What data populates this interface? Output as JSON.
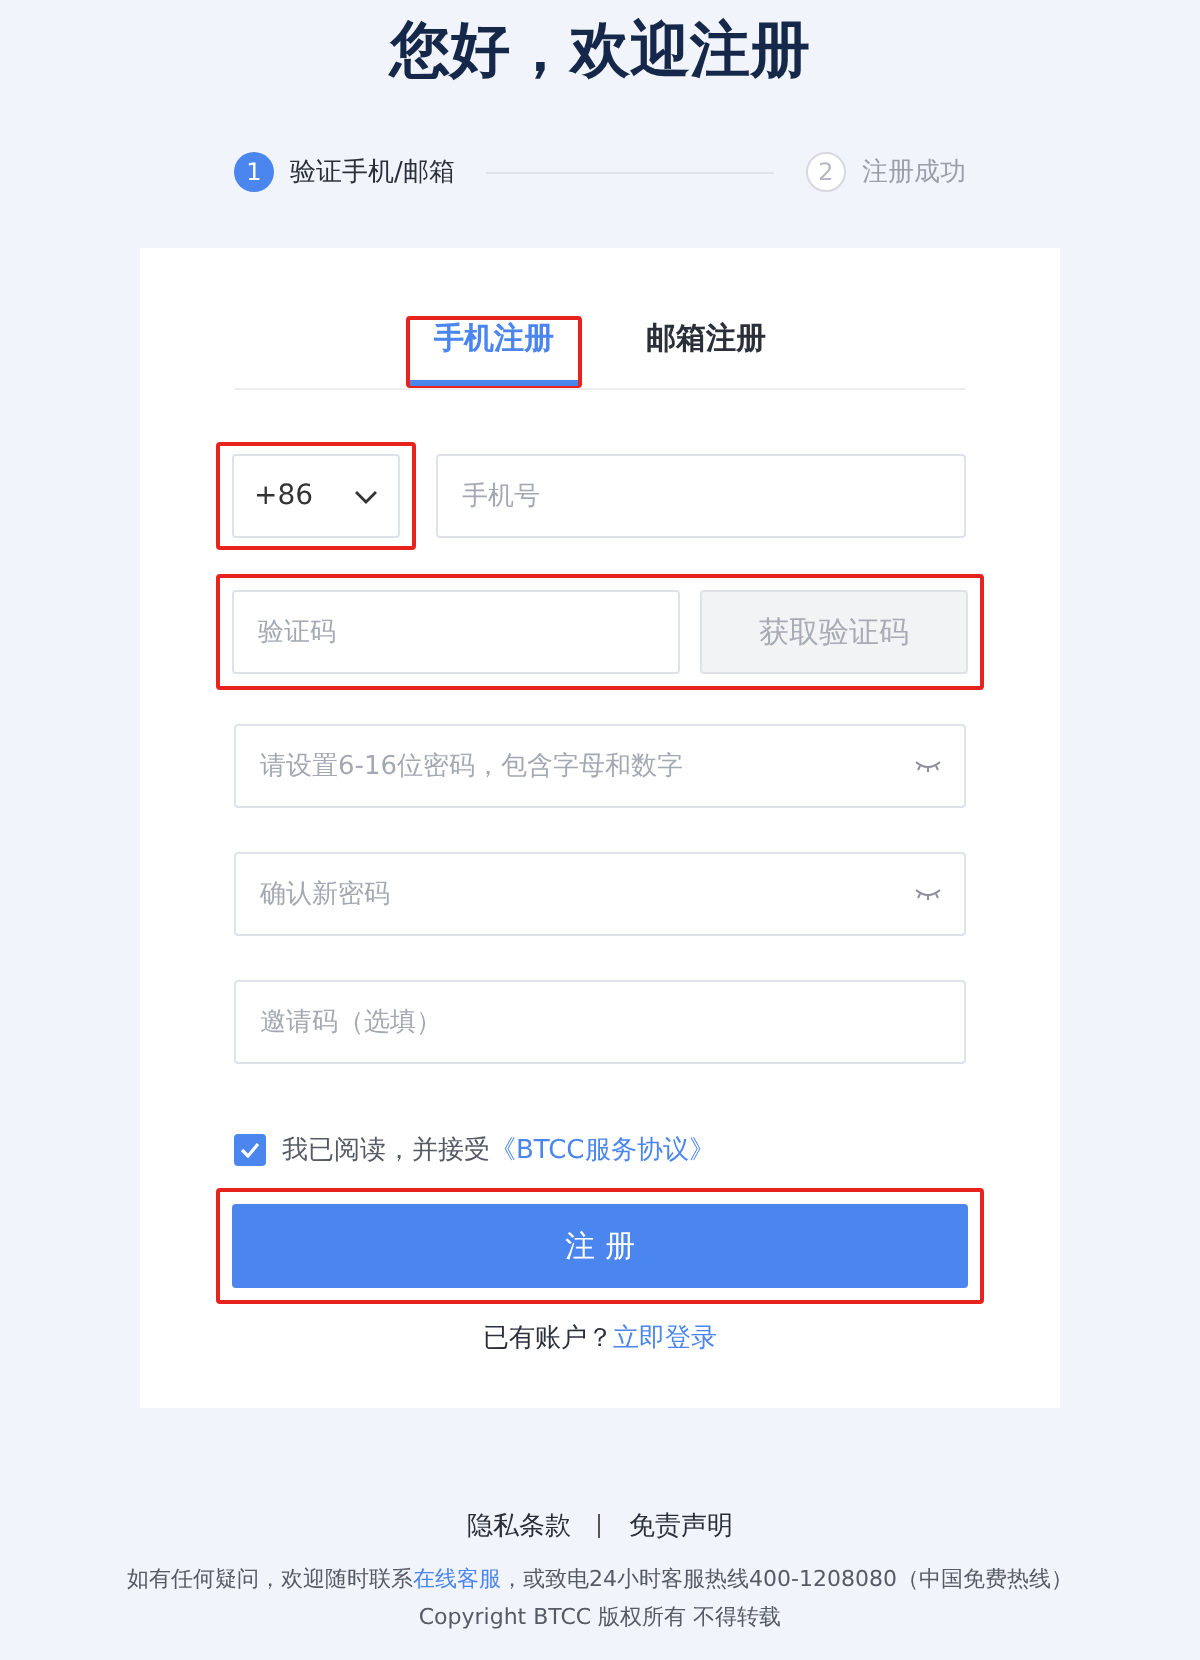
{
  "title": "您好，欢迎注册",
  "steps": [
    {
      "number": "1",
      "label": "验证手机/邮箱",
      "selected": true
    },
    {
      "number": "2",
      "label": "注册成功",
      "selected": false
    }
  ],
  "tabs": [
    {
      "label": "手机注册",
      "selected": true,
      "highlighted": true
    },
    {
      "label": "邮箱注册",
      "selected": false,
      "highlighted": false
    }
  ],
  "phone_row": {
    "country_code": "+86",
    "highlighted": true,
    "placeholder": "手机号"
  },
  "code_row": {
    "placeholder": "验证码",
    "button": "获取验证码",
    "disabled": true,
    "highlighted": true
  },
  "fields": [
    {
      "kind": "password",
      "placeholder": "请设置6-16位密码，包含字母和数字"
    },
    {
      "kind": "password",
      "placeholder": "确认新密码"
    },
    {
      "kind": "text",
      "placeholder": "邀请码（选填）"
    }
  ],
  "agreement": {
    "checked": true,
    "text": "我已阅读，并接受",
    "link": "《BTCC服务协议》"
  },
  "submit": {
    "label": "注 册",
    "highlighted": true
  },
  "login": {
    "text": "已有账户？",
    "link": "立即登录"
  },
  "footer": {
    "links": [
      "隐私条款",
      "免责声明"
    ],
    "contact": {
      "before": "如有任何疑问，欢迎随时联系",
      "link": "在线客服",
      "after": "，或致电24小时客服热线400-1208080（中国免费热线）"
    },
    "copyright": "Copyright BTCC 版权所有 不得转载"
  }
}
